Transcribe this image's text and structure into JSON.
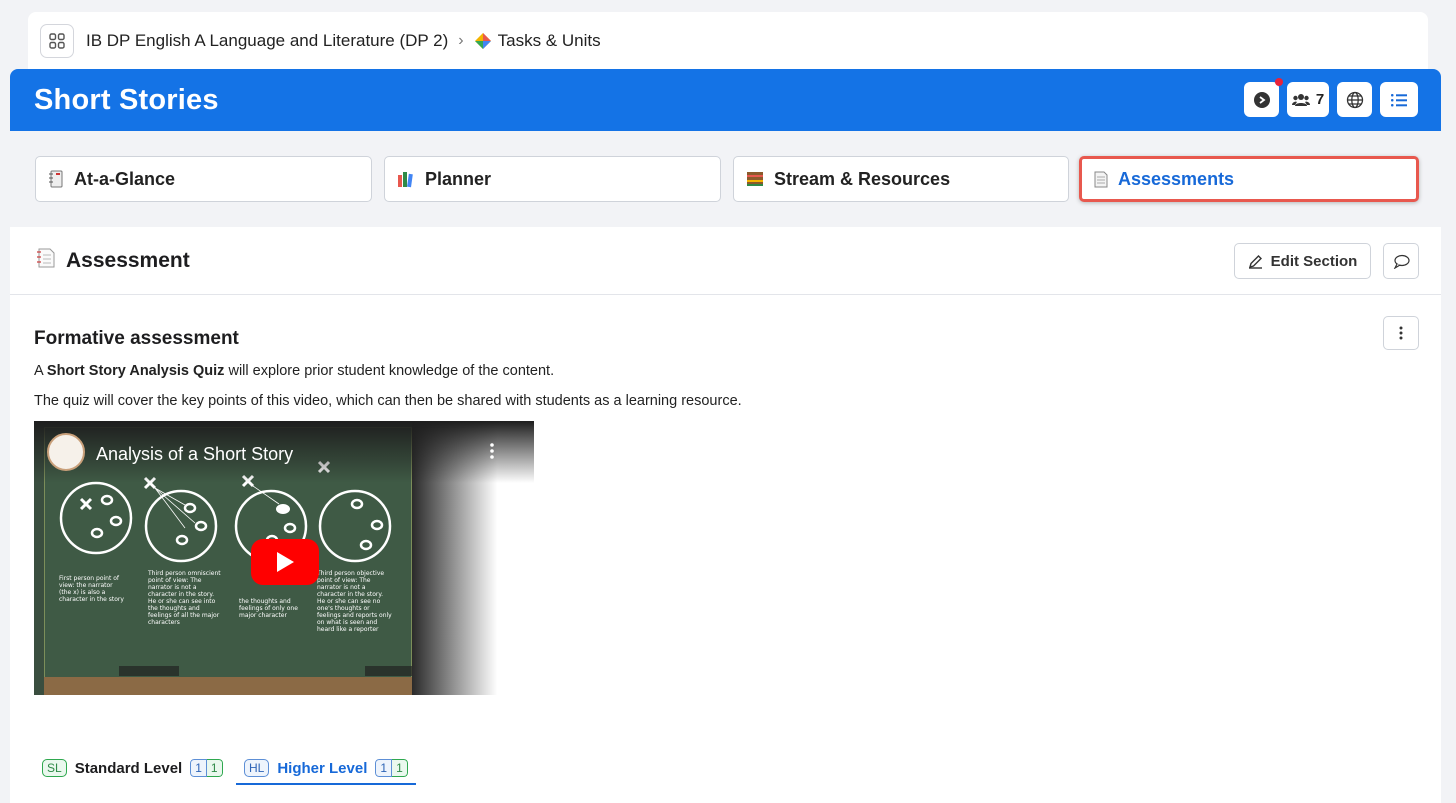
{
  "breadcrumb": {
    "course": "IB DP English A Language and Literature (DP 2)",
    "section": "Tasks & Units"
  },
  "header": {
    "title": "Short Stories",
    "members_count": "7",
    "color": "#1473e6"
  },
  "tabs": [
    {
      "label": "At-a-Glance",
      "icon": "notebook-icon"
    },
    {
      "label": "Planner",
      "icon": "books-icon"
    },
    {
      "label": "Stream & Resources",
      "icon": "stream-icon"
    },
    {
      "label": "Assessments",
      "icon": "page-icon",
      "active": true
    }
  ],
  "section": {
    "title": "Assessment",
    "edit_label": "Edit Section"
  },
  "content": {
    "heading": "Formative assessment",
    "p1_prefix": "A ",
    "p1_bold": "Short Story Analysis Quiz",
    "p1_suffix": " will explore prior student knowledge of the content.",
    "p2": "The quiz will cover the key points of this video, which can then be shared with students as a learning resource."
  },
  "video": {
    "title": "Analysis of a Short Story"
  },
  "levels": [
    {
      "badge": "SL",
      "label": "Standard Level",
      "count_a": "1",
      "count_b": "1"
    },
    {
      "badge": "HL",
      "label": "Higher Level",
      "count_a": "1",
      "count_b": "1",
      "active": true
    }
  ]
}
